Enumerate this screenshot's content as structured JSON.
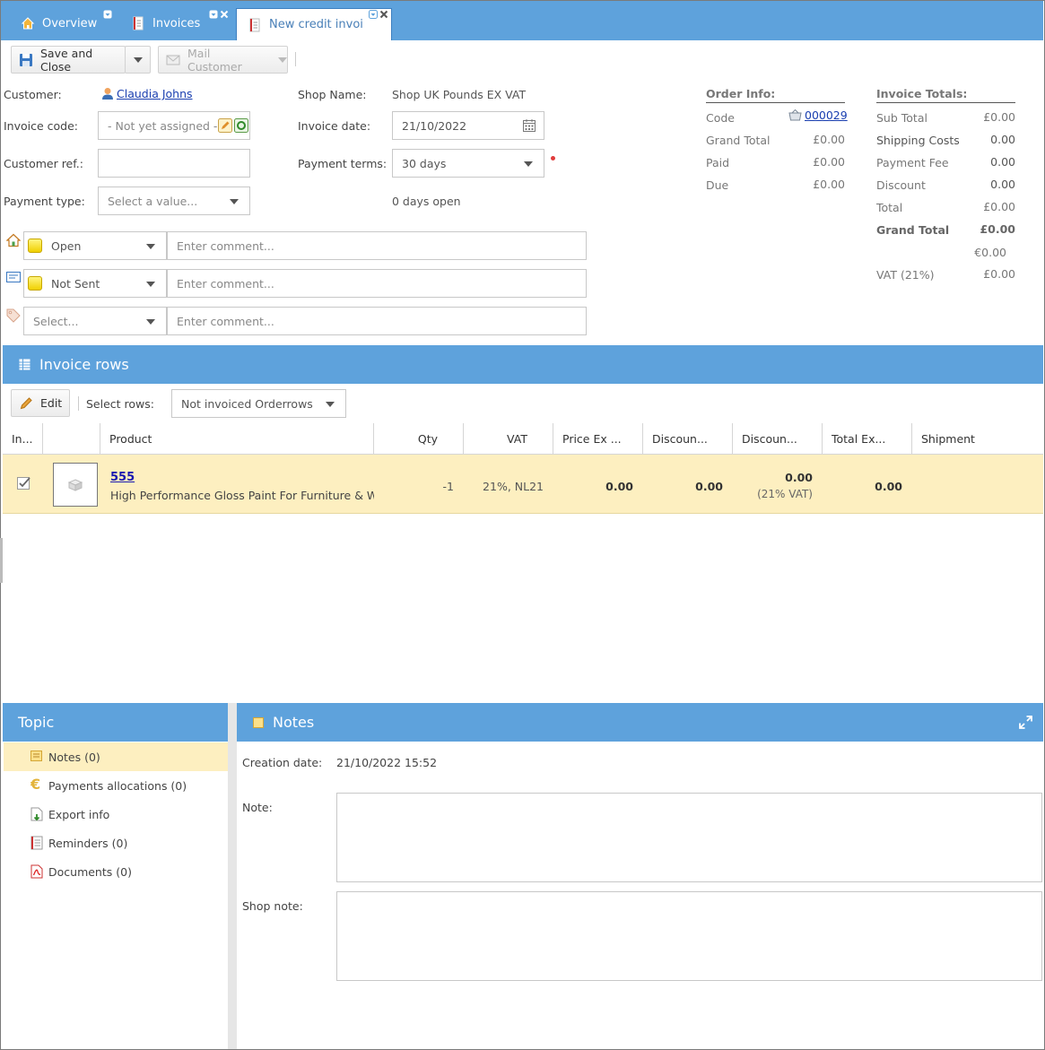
{
  "tabs": [
    {
      "label": "Overview"
    },
    {
      "label": "Invoices"
    },
    {
      "label": "New credit invoi"
    }
  ],
  "toolbar": {
    "save_close": "Save and Close",
    "mail_customer": "Mail Customer"
  },
  "form": {
    "customer_label": "Customer:",
    "customer_value": "Claudia Johns",
    "invoice_code_label": "Invoice code:",
    "invoice_code_value": "- Not yet assigned -",
    "customer_ref_label": "Customer ref.:",
    "customer_ref_value": "",
    "payment_type_label": "Payment type:",
    "payment_type_placeholder": "Select a value...",
    "shop_name_label": "Shop Name:",
    "shop_name_value": "Shop UK Pounds EX VAT",
    "invoice_date_label": "Invoice date:",
    "invoice_date_value": "21/10/2022",
    "payment_terms_label": "Payment terms:",
    "payment_terms_value": "30 days",
    "days_open": "0 days open"
  },
  "status_rows": [
    {
      "value": "Open",
      "comment_placeholder": "Enter comment..."
    },
    {
      "value": "Not Sent",
      "comment_placeholder": "Enter comment..."
    },
    {
      "value": "Select...",
      "comment_placeholder": "Enter comment..."
    }
  ],
  "order_info": {
    "title": "Order Info:",
    "rows": [
      {
        "label": "Code",
        "value": "000029"
      },
      {
        "label": "Grand Total",
        "value": "£0.00"
      },
      {
        "label": "Paid",
        "value": "£0.00"
      },
      {
        "label": "Due",
        "value": "£0.00"
      }
    ]
  },
  "invoice_totals": {
    "title": "Invoice Totals:",
    "rows": [
      {
        "label": "Sub Total",
        "value": "£0.00"
      },
      {
        "label": "Shipping Costs",
        "value": "0.00"
      },
      {
        "label": "Payment Fee",
        "value": "0.00"
      },
      {
        "label": "Discount",
        "value": "0.00"
      },
      {
        "label": "Total",
        "value": "£0.00"
      },
      {
        "label": "Grand Total",
        "value": "£0.00"
      },
      {
        "label": "",
        "value": "€0.00"
      },
      {
        "label": "VAT (21%)",
        "value": "£0.00"
      }
    ]
  },
  "invoice_rows": {
    "title": "Invoice rows",
    "edit_label": "Edit",
    "select_rows_label": "Select rows:",
    "select_rows_value": "Not invoiced Orderrows",
    "columns": [
      "In...",
      "",
      "Product",
      "Qty",
      "VAT",
      "Price Ex ...",
      "Discoun...",
      "Discoun...",
      "Total Ex...",
      "Shipment"
    ],
    "rows": [
      {
        "product_code": "555",
        "product_name": "High Performance Gloss Paint For Furniture & Woo",
        "qty": "-1",
        "vat": "21%, NL21",
        "price_ex": "0.00",
        "discount1": "0.00",
        "discount2": "0.00",
        "discount2_sub": "(21% VAT)",
        "total_ex": "0.00",
        "shipment": ""
      }
    ]
  },
  "topic": {
    "title": "Topic",
    "items": [
      {
        "label": "Notes (0)"
      },
      {
        "label": "Payments allocations (0)"
      },
      {
        "label": "Export info"
      },
      {
        "label": "Reminders (0)"
      },
      {
        "label": "Documents (0)"
      }
    ]
  },
  "notes": {
    "title": "Notes",
    "creation_date_label": "Creation date:",
    "creation_date_value": "21/10/2022 15:52",
    "note_label": "Note:",
    "shop_note_label": "Shop note:"
  },
  "colors": {
    "header_blue": "#5ea2dc",
    "selected_row": "#fdefc0",
    "link": "#1a3fb0"
  }
}
